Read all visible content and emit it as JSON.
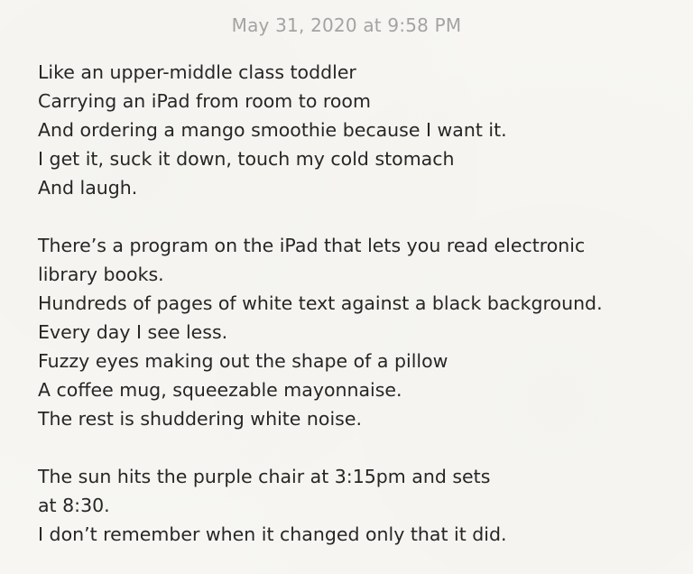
{
  "note": {
    "timestamp": "May 31, 2020 at 9:58 PM",
    "stanza1": [
      "Like an upper-middle class toddler",
      "Carrying an iPad from room to room",
      "And ordering a mango smoothie because I want it.",
      "I get it, suck it down, touch my cold stomach",
      "And laugh."
    ],
    "stanza2": [
      "There’s a program on the iPad that lets you read electronic",
      "library books.",
      "Hundreds of pages of white text against a black background.",
      "Every day I see less.",
      "Fuzzy eyes making out the shape of a pillow",
      "A coffee mug, squeezable mayonnaise.",
      "The rest is shuddering white noise."
    ],
    "stanza3": [
      "The sun hits the purple chair at 3:15pm and sets",
      "at 8:30.",
      "I don’t remember when it changed only that it did."
    ]
  },
  "colors": {
    "background": "#f7f6f2",
    "timestamp": "#a3a3a3",
    "text": "#262626"
  }
}
